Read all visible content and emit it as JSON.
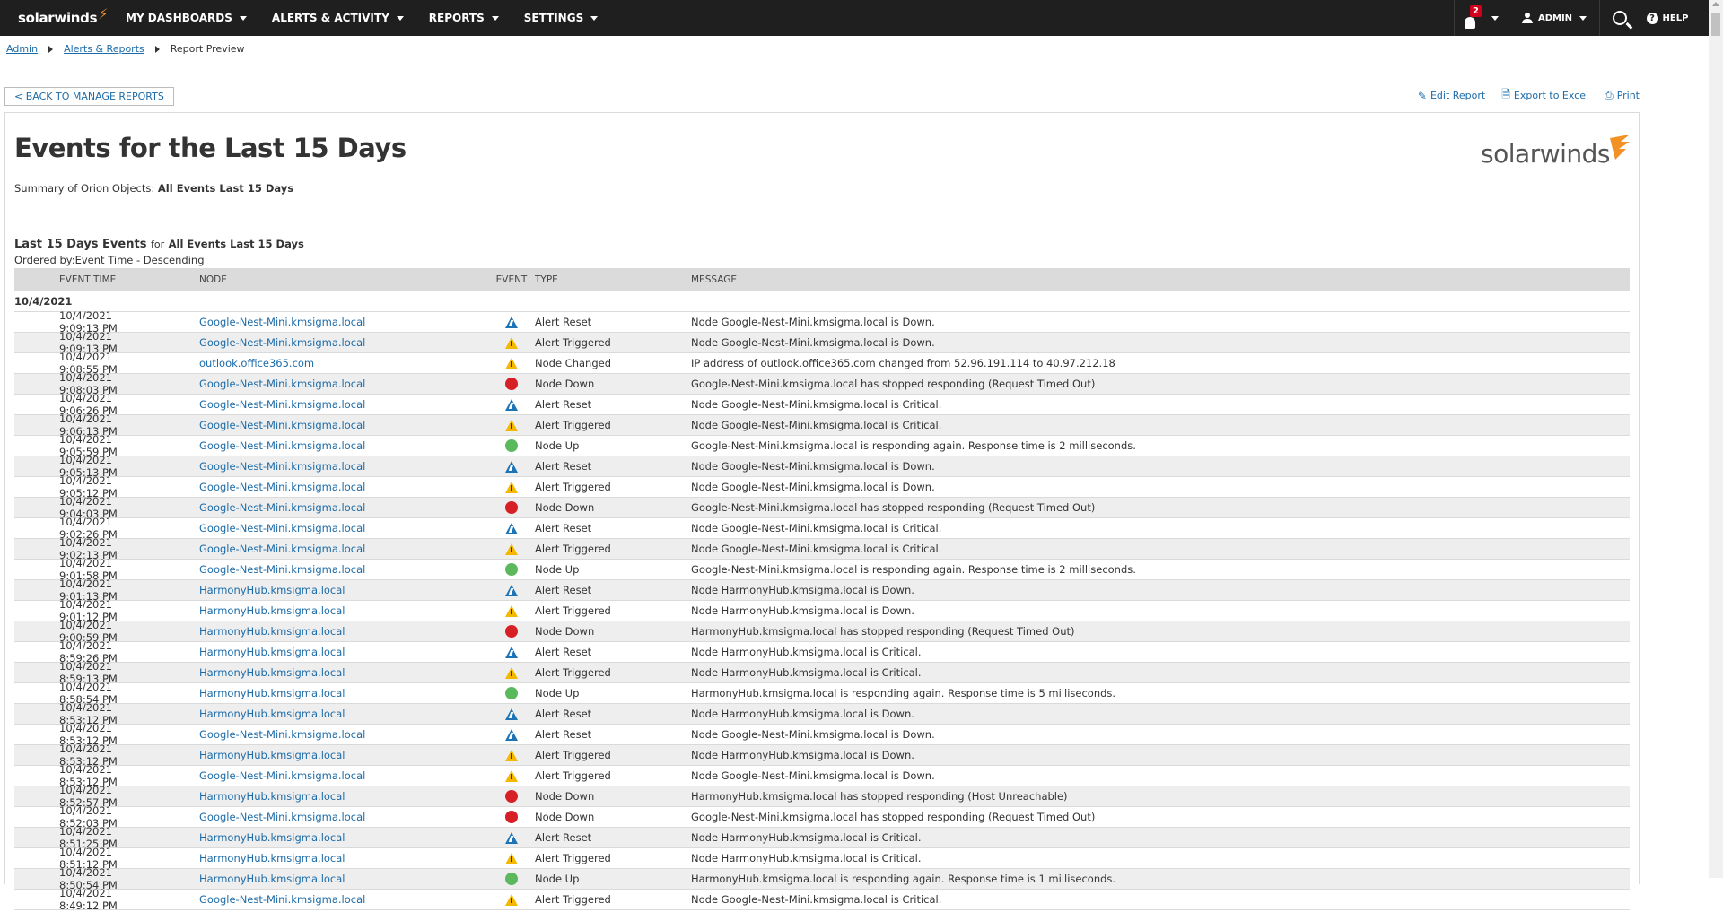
{
  "nav": {
    "brand": "solarwinds",
    "menus": [
      "MY DASHBOARDS",
      "ALERTS & ACTIVITY",
      "REPORTS",
      "SETTINGS"
    ],
    "notification_count": "2",
    "user": "ADMIN",
    "help": "HELP"
  },
  "breadcrumb": [
    "Admin",
    "Alerts & Reports",
    "Report Preview"
  ],
  "back_button": "< BACK TO MANAGE REPORTS",
  "actions": [
    "Edit Report",
    "Export to Excel",
    "Print"
  ],
  "report": {
    "title": "Events for the Last 15 Days",
    "summary_label": "Summary of Orion Objects:",
    "summary_value": "All Events Last 15 Days",
    "brand_logo": "solarwinds",
    "section_title": "Last 15 Days Events",
    "section_for": "for",
    "section_object": "All Events Last 15 Days",
    "ordered_by": "Ordered by:Event Time - Descending"
  },
  "table": {
    "headers": [
      "EVENT TIME",
      "NODE",
      "EVENT",
      "TYPE",
      "MESSAGE"
    ],
    "date_group": "10/4/2021",
    "rows": [
      {
        "time": "10/4/2021 9:09:13 PM",
        "node": "Google-Nest-Mini.kmsigma.local",
        "icon": "alert-reset",
        "type": "Alert Reset",
        "message": "Node Google-Nest-Mini.kmsigma.local is Down."
      },
      {
        "time": "10/4/2021 9:09:13 PM",
        "node": "Google-Nest-Mini.kmsigma.local",
        "icon": "alert-triggered",
        "type": "Alert Triggered",
        "message": "Node Google-Nest-Mini.kmsigma.local is Down."
      },
      {
        "time": "10/4/2021 9:08:55 PM",
        "node": "outlook.office365.com",
        "icon": "alert-triggered",
        "type": "Node Changed",
        "message": "IP address of outlook.office365.com changed from 52.96.191.114 to 40.97.212.18"
      },
      {
        "time": "10/4/2021 9:08:03 PM",
        "node": "Google-Nest-Mini.kmsigma.local",
        "icon": "node-down",
        "type": "Node Down",
        "message": "Google-Nest-Mini.kmsigma.local has stopped responding (Request Timed Out)"
      },
      {
        "time": "10/4/2021 9:06:26 PM",
        "node": "Google-Nest-Mini.kmsigma.local",
        "icon": "alert-reset",
        "type": "Alert Reset",
        "message": "Node Google-Nest-Mini.kmsigma.local is Critical."
      },
      {
        "time": "10/4/2021 9:06:13 PM",
        "node": "Google-Nest-Mini.kmsigma.local",
        "icon": "alert-triggered",
        "type": "Alert Triggered",
        "message": "Node Google-Nest-Mini.kmsigma.local is Critical."
      },
      {
        "time": "10/4/2021 9:05:59 PM",
        "node": "Google-Nest-Mini.kmsigma.local",
        "icon": "node-up",
        "type": "Node Up",
        "message": "Google-Nest-Mini.kmsigma.local is responding again. Response time is 2 milliseconds."
      },
      {
        "time": "10/4/2021 9:05:13 PM",
        "node": "Google-Nest-Mini.kmsigma.local",
        "icon": "alert-reset",
        "type": "Alert Reset",
        "message": "Node Google-Nest-Mini.kmsigma.local is Down."
      },
      {
        "time": "10/4/2021 9:05:12 PM",
        "node": "Google-Nest-Mini.kmsigma.local",
        "icon": "alert-triggered",
        "type": "Alert Triggered",
        "message": "Node Google-Nest-Mini.kmsigma.local is Down."
      },
      {
        "time": "10/4/2021 9:04:03 PM",
        "node": "Google-Nest-Mini.kmsigma.local",
        "icon": "node-down",
        "type": "Node Down",
        "message": "Google-Nest-Mini.kmsigma.local has stopped responding (Request Timed Out)"
      },
      {
        "time": "10/4/2021 9:02:26 PM",
        "node": "Google-Nest-Mini.kmsigma.local",
        "icon": "alert-reset",
        "type": "Alert Reset",
        "message": "Node Google-Nest-Mini.kmsigma.local is Critical."
      },
      {
        "time": "10/4/2021 9:02:13 PM",
        "node": "Google-Nest-Mini.kmsigma.local",
        "icon": "alert-triggered",
        "type": "Alert Triggered",
        "message": "Node Google-Nest-Mini.kmsigma.local is Critical."
      },
      {
        "time": "10/4/2021 9:01:58 PM",
        "node": "Google-Nest-Mini.kmsigma.local",
        "icon": "node-up",
        "type": "Node Up",
        "message": "Google-Nest-Mini.kmsigma.local is responding again. Response time is 2 milliseconds."
      },
      {
        "time": "10/4/2021 9:01:13 PM",
        "node": "HarmonyHub.kmsigma.local",
        "icon": "alert-reset",
        "type": "Alert Reset",
        "message": "Node HarmonyHub.kmsigma.local is Down."
      },
      {
        "time": "10/4/2021 9:01:12 PM",
        "node": "HarmonyHub.kmsigma.local",
        "icon": "alert-triggered",
        "type": "Alert Triggered",
        "message": "Node HarmonyHub.kmsigma.local is Down."
      },
      {
        "time": "10/4/2021 9:00:59 PM",
        "node": "HarmonyHub.kmsigma.local",
        "icon": "node-down",
        "type": "Node Down",
        "message": "HarmonyHub.kmsigma.local has stopped responding (Request Timed Out)"
      },
      {
        "time": "10/4/2021 8:59:26 PM",
        "node": "HarmonyHub.kmsigma.local",
        "icon": "alert-reset",
        "type": "Alert Reset",
        "message": "Node HarmonyHub.kmsigma.local is Critical."
      },
      {
        "time": "10/4/2021 8:59:13 PM",
        "node": "HarmonyHub.kmsigma.local",
        "icon": "alert-triggered",
        "type": "Alert Triggered",
        "message": "Node HarmonyHub.kmsigma.local is Critical."
      },
      {
        "time": "10/4/2021 8:58:54 PM",
        "node": "HarmonyHub.kmsigma.local",
        "icon": "node-up",
        "type": "Node Up",
        "message": "HarmonyHub.kmsigma.local is responding again. Response time is 5 milliseconds."
      },
      {
        "time": "10/4/2021 8:53:12 PM",
        "node": "HarmonyHub.kmsigma.local",
        "icon": "alert-reset",
        "type": "Alert Reset",
        "message": "Node HarmonyHub.kmsigma.local is Down."
      },
      {
        "time": "10/4/2021 8:53:12 PM",
        "node": "Google-Nest-Mini.kmsigma.local",
        "icon": "alert-reset",
        "type": "Alert Reset",
        "message": "Node Google-Nest-Mini.kmsigma.local is Down."
      },
      {
        "time": "10/4/2021 8:53:12 PM",
        "node": "HarmonyHub.kmsigma.local",
        "icon": "alert-triggered",
        "type": "Alert Triggered",
        "message": "Node HarmonyHub.kmsigma.local is Down."
      },
      {
        "time": "10/4/2021 8:53:12 PM",
        "node": "Google-Nest-Mini.kmsigma.local",
        "icon": "alert-triggered",
        "type": "Alert Triggered",
        "message": "Node Google-Nest-Mini.kmsigma.local is Down."
      },
      {
        "time": "10/4/2021 8:52:57 PM",
        "node": "HarmonyHub.kmsigma.local",
        "icon": "node-down",
        "type": "Node Down",
        "message": "HarmonyHub.kmsigma.local has stopped responding (Host Unreachable)"
      },
      {
        "time": "10/4/2021 8:52:03 PM",
        "node": "Google-Nest-Mini.kmsigma.local",
        "icon": "node-down",
        "type": "Node Down",
        "message": "Google-Nest-Mini.kmsigma.local has stopped responding (Request Timed Out)"
      },
      {
        "time": "10/4/2021 8:51:25 PM",
        "node": "HarmonyHub.kmsigma.local",
        "icon": "alert-reset",
        "type": "Alert Reset",
        "message": "Node HarmonyHub.kmsigma.local is Critical."
      },
      {
        "time": "10/4/2021 8:51:12 PM",
        "node": "HarmonyHub.kmsigma.local",
        "icon": "alert-triggered",
        "type": "Alert Triggered",
        "message": "Node HarmonyHub.kmsigma.local is Critical."
      },
      {
        "time": "10/4/2021 8:50:54 PM",
        "node": "HarmonyHub.kmsigma.local",
        "icon": "node-up",
        "type": "Node Up",
        "message": "HarmonyHub.kmsigma.local is responding again. Response time is 1 milliseconds."
      },
      {
        "time": "10/4/2021 8:49:12 PM",
        "node": "Google-Nest-Mini.kmsigma.local",
        "icon": "alert-triggered",
        "type": "Alert Triggered",
        "message": "Node Google-Nest-Mini.kmsigma.local is Critical."
      }
    ]
  }
}
